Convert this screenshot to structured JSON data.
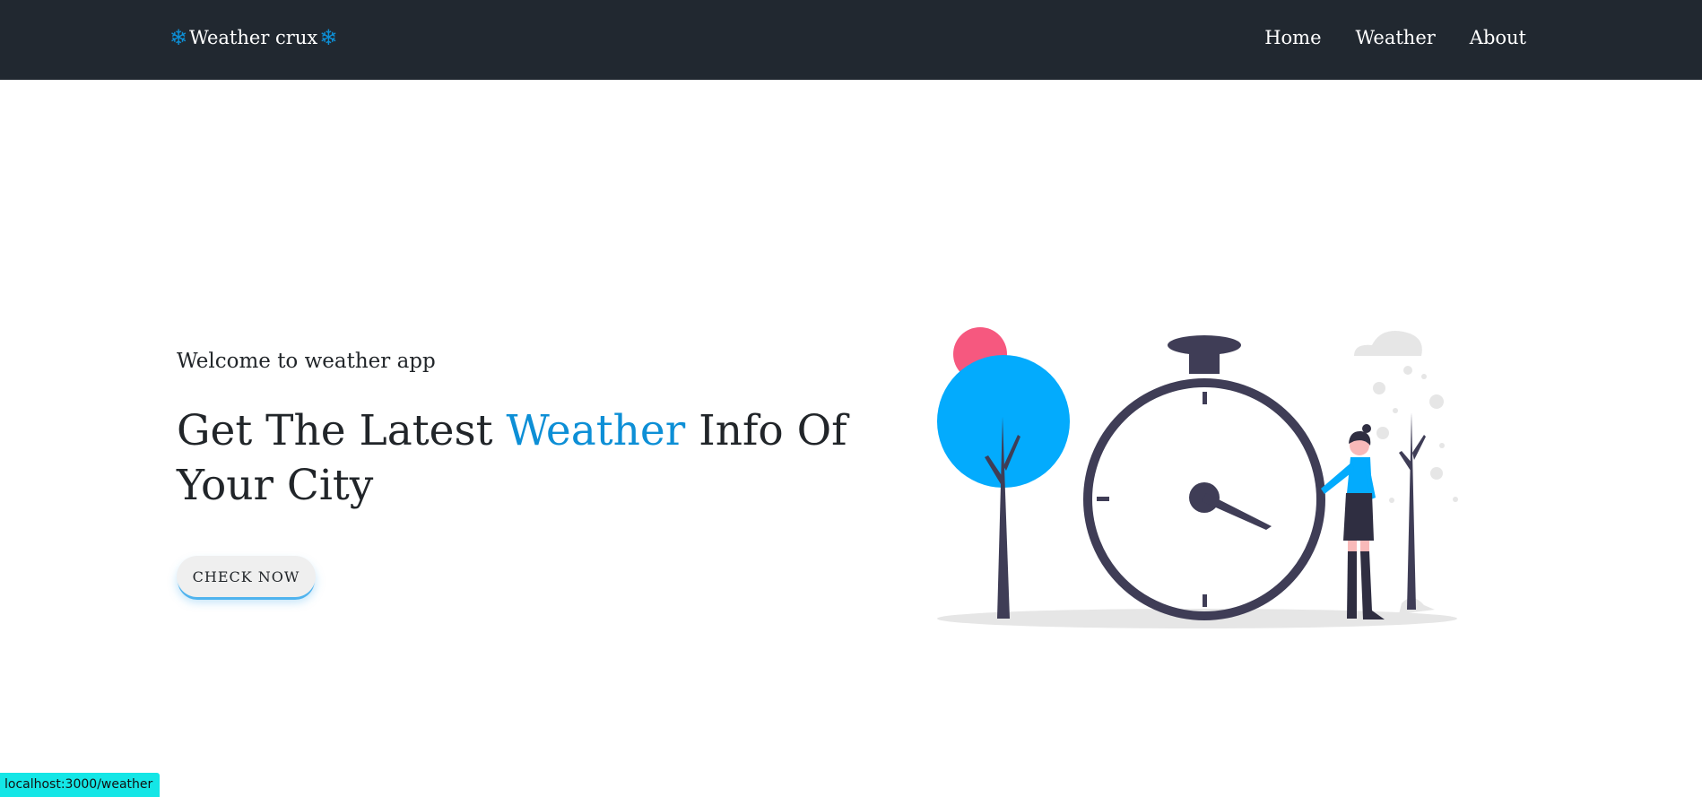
{
  "navbar": {
    "brand": "Weather crux",
    "brand_icon": "snowflake-icon",
    "links": [
      "Home",
      "Weather",
      "About"
    ]
  },
  "hero": {
    "welcome": "Welcome to weather app",
    "headline_before": "Get The Latest",
    "headline_accent": "Weather",
    "headline_after": "Info Of Your City",
    "cta": "CHECK NOW"
  },
  "status_bar": {
    "url": "localhost:3000/weather"
  },
  "colors": {
    "navbar_bg": "#212830",
    "accent": "#0d8fd6",
    "tree": "#03abfd",
    "sun": "#f6587f",
    "dark": "#3f3d56",
    "status_bg": "#14e6e6"
  }
}
